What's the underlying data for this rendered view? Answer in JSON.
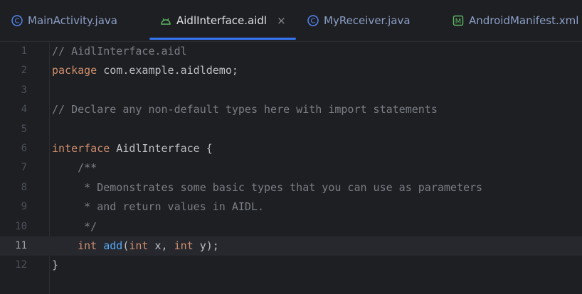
{
  "tabs": [
    {
      "label": "MainActivity.java",
      "icon": "class-c-icon",
      "active": false
    },
    {
      "label": "AidlInterface.aidl",
      "icon": "android-icon",
      "active": true,
      "close": "×"
    },
    {
      "label": "MyReceiver.java",
      "icon": "class-c-icon",
      "active": false
    },
    {
      "label": "AndroidManifest.xml",
      "icon": "manifest-m-icon",
      "active": false
    }
  ],
  "colors": {
    "background": "#1e1f22",
    "accent": "#3574f0",
    "keyword": "#cf8e6d",
    "comment": "#7a7e85",
    "function": "#56a8f5"
  },
  "editor": {
    "current_line": 11,
    "lines": [
      {
        "n": "1",
        "parts": [
          {
            "t": "// AidlInterface.aidl",
            "c": "cmt"
          }
        ]
      },
      {
        "n": "2",
        "parts": [
          {
            "t": "package",
            "c": "kw"
          },
          {
            "t": " com.example.aidldemo;",
            "c": ""
          }
        ]
      },
      {
        "n": "3",
        "parts": []
      },
      {
        "n": "4",
        "parts": [
          {
            "t": "// Declare any non-default types here with import statements",
            "c": "cmt"
          }
        ]
      },
      {
        "n": "5",
        "parts": []
      },
      {
        "n": "6",
        "parts": [
          {
            "t": "interface",
            "c": "kw"
          },
          {
            "t": " AidlInterface {",
            "c": ""
          }
        ]
      },
      {
        "n": "7",
        "parts": [
          {
            "t": "    /**",
            "c": "cmt"
          }
        ]
      },
      {
        "n": "8",
        "parts": [
          {
            "t": "     * Demonstrates some basic types that you can use as parameters",
            "c": "cmt"
          }
        ]
      },
      {
        "n": "9",
        "parts": [
          {
            "t": "     * and return values in AIDL.",
            "c": "cmt"
          }
        ]
      },
      {
        "n": "10",
        "parts": [
          {
            "t": "     */",
            "c": "cmt"
          }
        ]
      },
      {
        "n": "11",
        "parts": [
          {
            "t": "    ",
            "c": ""
          },
          {
            "t": "int",
            "c": "kw"
          },
          {
            "t": " ",
            "c": ""
          },
          {
            "t": "add",
            "c": "fn"
          },
          {
            "t": "(",
            "c": ""
          },
          {
            "t": "int",
            "c": "kw"
          },
          {
            "t": " x, ",
            "c": ""
          },
          {
            "t": "int",
            "c": "kw"
          },
          {
            "t": " y);",
            "c": ""
          }
        ]
      },
      {
        "n": "12",
        "parts": [
          {
            "t": "}",
            "c": ""
          }
        ]
      }
    ]
  }
}
